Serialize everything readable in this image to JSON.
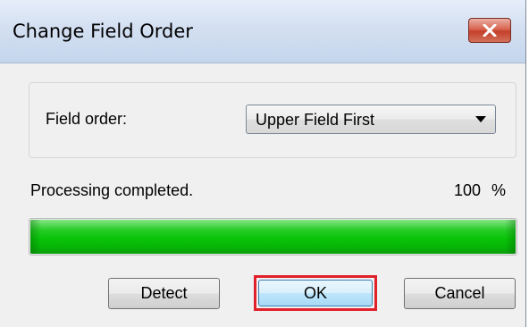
{
  "window": {
    "title": "Change Field Order",
    "close_icon": "close-x-icon"
  },
  "field_order": {
    "label": "Field order:",
    "selected": "Upper Field First"
  },
  "status": {
    "message": "Processing completed.",
    "percent": "100",
    "percent_sign": "%"
  },
  "progress": {
    "value_percent": 100,
    "color": "#09c409"
  },
  "buttons": {
    "detect": "Detect",
    "ok": "OK",
    "cancel": "Cancel"
  },
  "colors": {
    "highlight_box": "#e0202a",
    "close_button": "#c4402b"
  }
}
